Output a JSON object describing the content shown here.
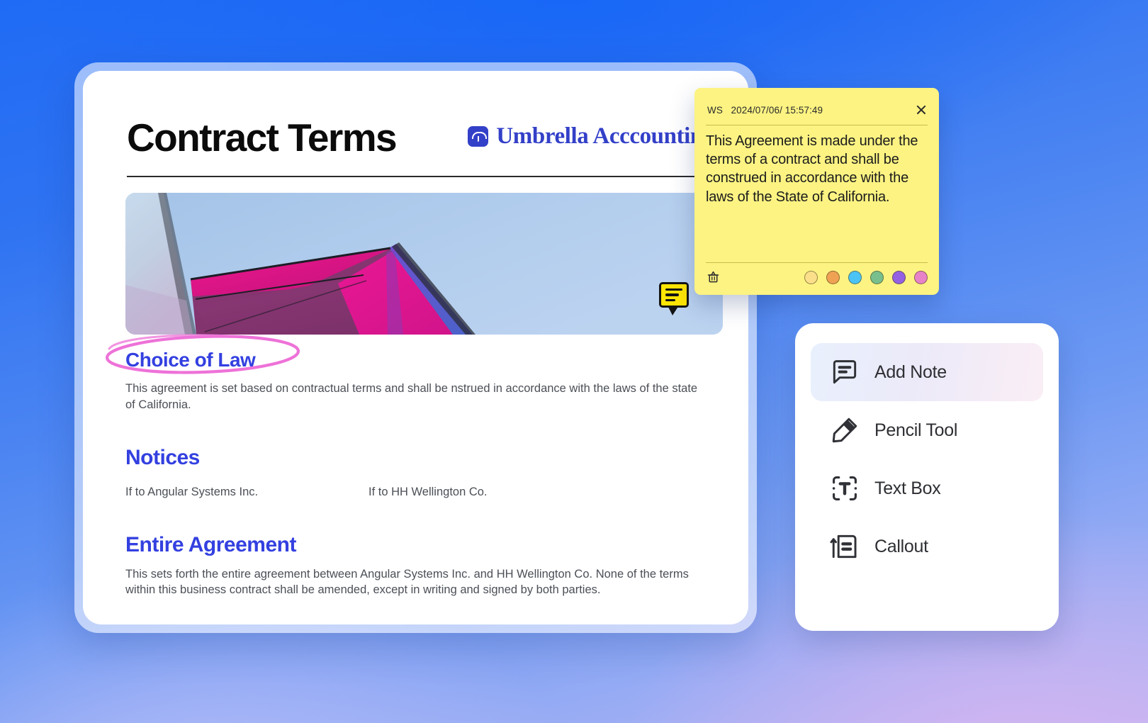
{
  "document": {
    "title": "Contract Terms",
    "brand": "Umbrella Acccounting",
    "brand_color": "#3340c8",
    "hero_pin_icon": "comment-icon",
    "sections": [
      {
        "heading": "Choice of Law",
        "annotation": "pink-ellipse-highlight",
        "body": "This agreement is set based on contractual terms and shall be nstrued in accordance with the laws of the state of California."
      },
      {
        "heading": "Notices",
        "col_left": "If to Angular Systems Inc.",
        "col_right": "If to HH Wellington Co."
      },
      {
        "heading": "Entire Agreement",
        "body": "This sets forth the entire agreement between Angular Systems Inc. and HH Wellington Co. None of the terms within this business contract shall be amended, except in writing and signed by both parties."
      }
    ],
    "heading_color": "#3340e0"
  },
  "sticky_note": {
    "author": "WS",
    "timestamp": "2024/07/06/ 15:57:49",
    "body": "This Agreement is made under the terms of a contract and shall be construed in accordance with the laws of the State of California.",
    "background": "#fcf382",
    "close_icon": "close-icon",
    "delete_icon": "trash-icon",
    "colors": [
      {
        "name": "yellow",
        "hex": "#fbdf8a"
      },
      {
        "name": "orange",
        "hex": "#efa254"
      },
      {
        "name": "blue",
        "hex": "#4cc3f5"
      },
      {
        "name": "green",
        "hex": "#78bf8d"
      },
      {
        "name": "purple",
        "hex": "#9461e3"
      },
      {
        "name": "pink",
        "hex": "#e782c8"
      }
    ]
  },
  "tool_panel": {
    "items": [
      {
        "label": "Add Note",
        "icon": "comment-icon",
        "active": true
      },
      {
        "label": "Pencil Tool",
        "icon": "pencil-icon",
        "active": false
      },
      {
        "label": "Text Box",
        "icon": "text-box-icon",
        "active": false
      },
      {
        "label": "Callout",
        "icon": "callout-icon",
        "active": false
      }
    ]
  }
}
